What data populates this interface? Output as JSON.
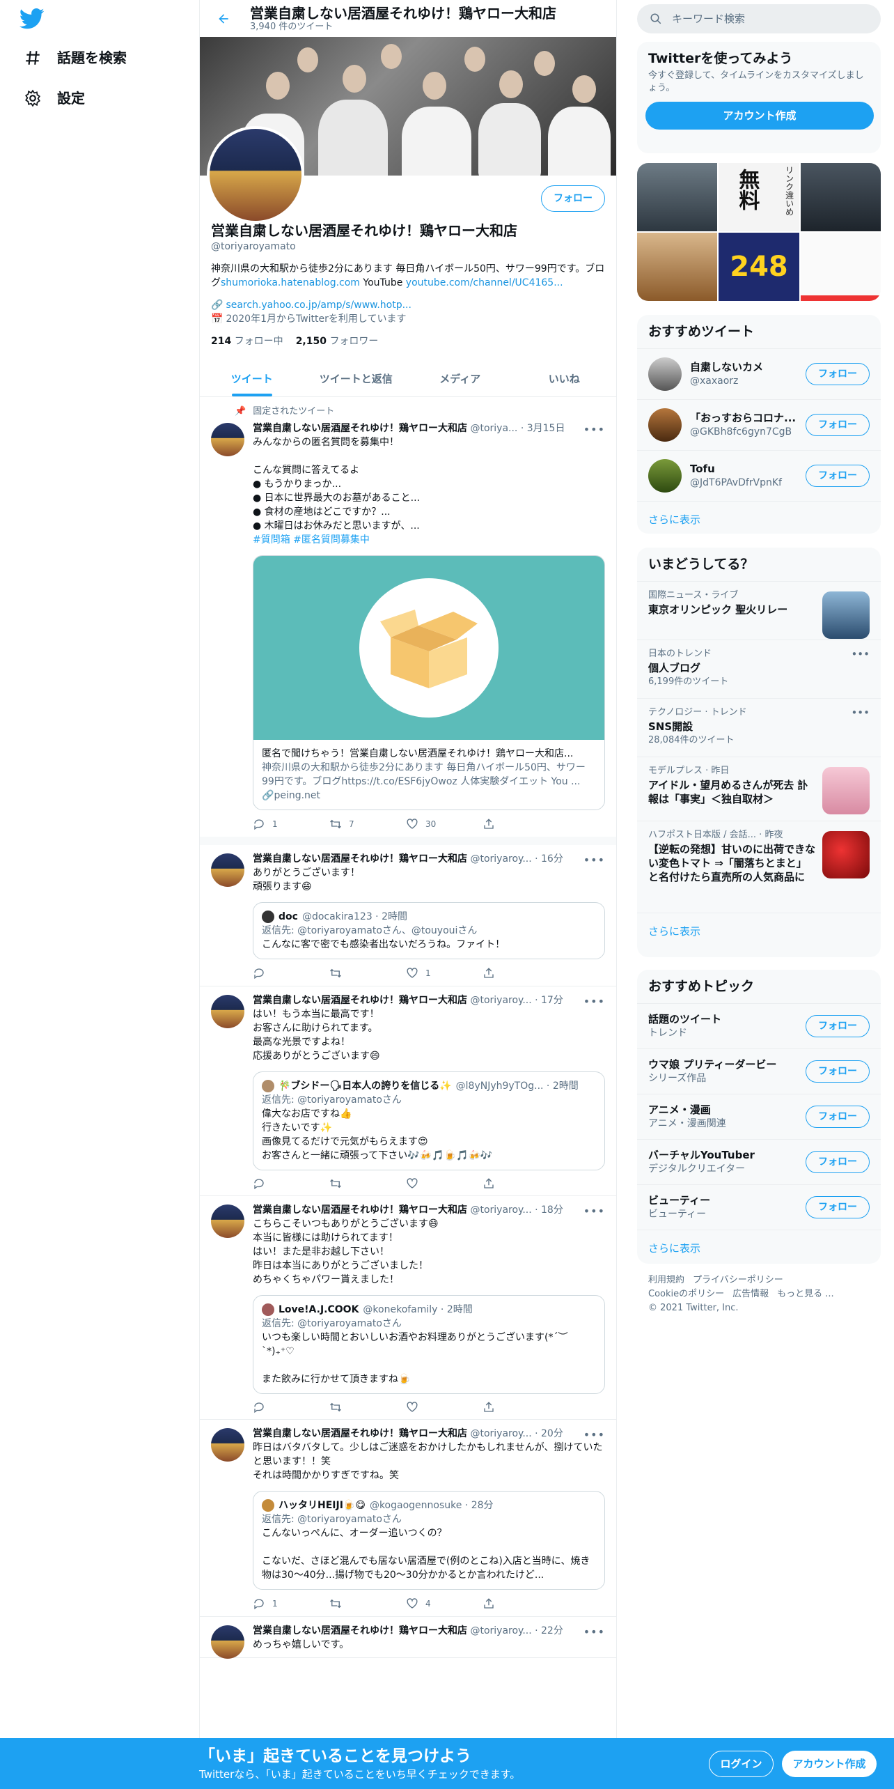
{
  "nav": {
    "explore": "話題を検索",
    "settings": "設定"
  },
  "header": {
    "name": "営業自粛しない居酒屋それゆけ！鶏ヤロー大和店",
    "tweet_count": "3,940 件のツイート"
  },
  "profile": {
    "follow": "フォロー",
    "name": "営業自粛しない居酒屋それゆけ！鶏ヤロー大和店",
    "handle": "@toriyaroyamato",
    "bio_text": "神奈川県の大和駅から徒歩2分にあります 毎日角ハイボール50円、サワー99円です。ブログ",
    "bio_link1": "shumorioka.hatenablog.com",
    "bio_mid": " YouTube ",
    "bio_link2": "youtube.com/channel/UC4165...",
    "link": "search.yahoo.co.jp/amp/s/www.hotp...",
    "joined": "2020年1月からTwitterを利用しています",
    "following_count": "214",
    "following_label": "フォロー中",
    "followers_count": "2,150",
    "followers_label": "フォロワー"
  },
  "tabs": [
    "ツイート",
    "ツイートと返信",
    "メディア",
    "いいね"
  ],
  "tweets": [
    {
      "pinned": "固定されたツイート",
      "name": "営業自粛しない居酒屋それゆけ！鶏ヤロー大和店",
      "meta": "@toriya... · 3月15日",
      "text": "みんなからの匿名質問を募集中！\n\nこんな質問に答えてるよ\n● もうかりまっか...\n● 日本に世界最大のお墓があること...\n● 食材の産地はどこですか？...\n● 木曜日はお休みだと思いますが、...",
      "hashtags": "#質問箱 #匿名質問募集中",
      "card_title": "匿名で聞けちゃう！営業自粛しない居酒屋それゆけ！鶏ヤロー大和店...",
      "card_desc": "神奈川県の大和駅から徒歩2分にあります 毎日角ハイボール50円、サワー99円です。ブログhttps://t.co/ESF6jyOwoz 人体実験ダイエット You ...",
      "card_domain": "peing.net",
      "reply": "1",
      "retweet": "7",
      "like": "30"
    },
    {
      "name": "営業自粛しない居酒屋それゆけ！鶏ヤロー大和店",
      "meta": "@toriyaroy... · 16分",
      "text": "ありがとうございます！\n頑張ります😄",
      "q_name": "doc",
      "q_meta": "@docakira123 · 2時間",
      "q_reply": "返信先: @toriyaroyamatoさん、@touyouiさん",
      "q_text": "こんなに客で密でも感染者出ないだろうね。ファイト！",
      "reply": "",
      "retweet": "",
      "like": "1"
    },
    {
      "name": "営業自粛しない居酒屋それゆけ！鶏ヤロー大和店",
      "meta": "@toriyaroy... · 17分",
      "text": "はい！もう本当に最高です！\nお客さんに助けられてます。\n最高な光景ですよね！\n応援ありがとうございます😄",
      "q_name": "🎋ブシドー🗣日本人の誇りを信じる✨",
      "q_meta": "@l8yNJyh9yTOg... · 2時間",
      "q_reply": "返信先: @toriyaroyamatoさん",
      "q_text": "偉大なお店ですね👍\n行きたいです✨\n画像見てるだけで元気がもらえます😍\nお客さんと一緒に頑張って下さい🎶🍻🎵🍺🎵🍻🎶",
      "reply": "",
      "retweet": "",
      "like": ""
    },
    {
      "name": "営業自粛しない居酒屋それゆけ！鶏ヤロー大和店",
      "meta": "@toriyaroy... · 18分",
      "text": "こちらこそいつもありがとうございます😄\n本当に皆様には助けられてます！\nはい！また是非お越し下さい！\n昨日は本当にありがとうございました！\nめちゃくちゃパワー貰えました！",
      "q_name": "Love!A.J.COOK",
      "q_meta": "@konekofamily · 2時間",
      "q_reply": "返信先: @toriyaroyamatoさん",
      "q_text": "いつも楽しい時間とおいしいお酒やお料理ありがとうございます(*´︶`*)₊⁺♡\n\nまた飲みに行かせて頂きますね🍺",
      "reply": "",
      "retweet": "",
      "like": ""
    },
    {
      "name": "営業自粛しない居酒屋それゆけ！鶏ヤロー大和店",
      "meta": "@toriyaroy... · 20分",
      "text": "昨日はバタバタして。少しはご迷惑をおかけしたかもしれませんが、捌けていたと思います！！笑\nそれは時間かかりすぎですね。笑",
      "q_name": "ハッタリHEIJI🍺😋",
      "q_meta": "@kogaogennosuke · 28分",
      "q_reply": "返信先: @toriyaroyamatoさん",
      "q_text": "こんないっぺんに、オーダー追いつくの？\n\nこないだ、さほど混んでも居ない居酒屋で(例のとこね)入店と当時に、焼き物は30〜40分...揚げ物でも20〜30分かかるとか言われたけど...",
      "reply": "1",
      "retweet": "",
      "like": "4"
    },
    {
      "name": "営業自粛しない居酒屋それゆけ！鶏ヤロー大和店",
      "meta": "@toriyaroy... · 22分",
      "text": "めっちゃ嬉しいです。"
    }
  ],
  "right": {
    "search_placeholder": "キーワード検索",
    "signup_title": "Twitterを使ってみよう",
    "signup_desc": "今すぐ登録して、タイムラインをカスタマイズしましょう。",
    "signup_button": "アカウント作成",
    "media": {
      "free_text": "無料",
      "link_text": "リンク違いめ",
      "price": "248"
    },
    "recommended_title": "おすすめツイート",
    "recommended": [
      {
        "name": "自粛しないカメ",
        "handle": "@xaxaorz"
      },
      {
        "name": "「おっすおらコロナ...",
        "handle": "@GKBh8fc6gyn7CgB"
      },
      {
        "name": "Tofu",
        "handle": "@JdT6PAvDfrVpnKf"
      }
    ],
    "follow_label": "フォロー",
    "show_more": "さらに表示",
    "trends_title": "いまどうしてる？",
    "trends": [
      {
        "cat": "国際ニュース・ライブ",
        "title": "東京オリンピック 聖火リレー",
        "count": ""
      },
      {
        "cat": "日本のトレンド",
        "title": "個人ブログ",
        "count": "6,199件のツイート"
      },
      {
        "cat": "テクノロジー · トレンド",
        "title": "SNS開設",
        "count": "28,084件のツイート"
      },
      {
        "cat": "モデルプレス · 昨日",
        "title": "アイドル・望月めるさんが死去 訃報は「事実」＜独自取材＞",
        "count": ""
      },
      {
        "cat": "ハフポスト日本版 / 会話... · 昨夜",
        "title": "【逆転の発想】甘いのに出荷できない変色トマト ⇒「闇落ちとまと」と名付けたら直売所の人気商品に",
        "count": ""
      }
    ],
    "topics_title": "おすすめトピック",
    "topics": [
      {
        "title": "話題のツイート",
        "cat": "トレンド"
      },
      {
        "title": "ウマ娘 プリティーダービー",
        "cat": "シリーズ作品"
      },
      {
        "title": "アニメ・漫画",
        "cat": "アニメ・漫画関連"
      },
      {
        "title": "バーチャルYouTuber",
        "cat": "デジタルクリエイター"
      },
      {
        "title": "ビューティー",
        "cat": "ビューティー"
      }
    ],
    "footer": {
      "terms": "利用規約",
      "privacy": "プライバシーポリシー",
      "cookie": "Cookieのポリシー",
      "ads": "広告情報",
      "more": "もっと見る ...",
      "copyright": "© 2021 Twitter, Inc."
    }
  },
  "bottom": {
    "title": "「いま」起きていることを見つけよう",
    "subtitle": "Twitterなら、「いま」起きていることをいち早くチェックできます。",
    "login": "ログイン",
    "signup": "アカウント作成"
  },
  "colors": {
    "accent": "#1da1f2",
    "muted": "#5b7083",
    "border": "#ebeef0"
  }
}
